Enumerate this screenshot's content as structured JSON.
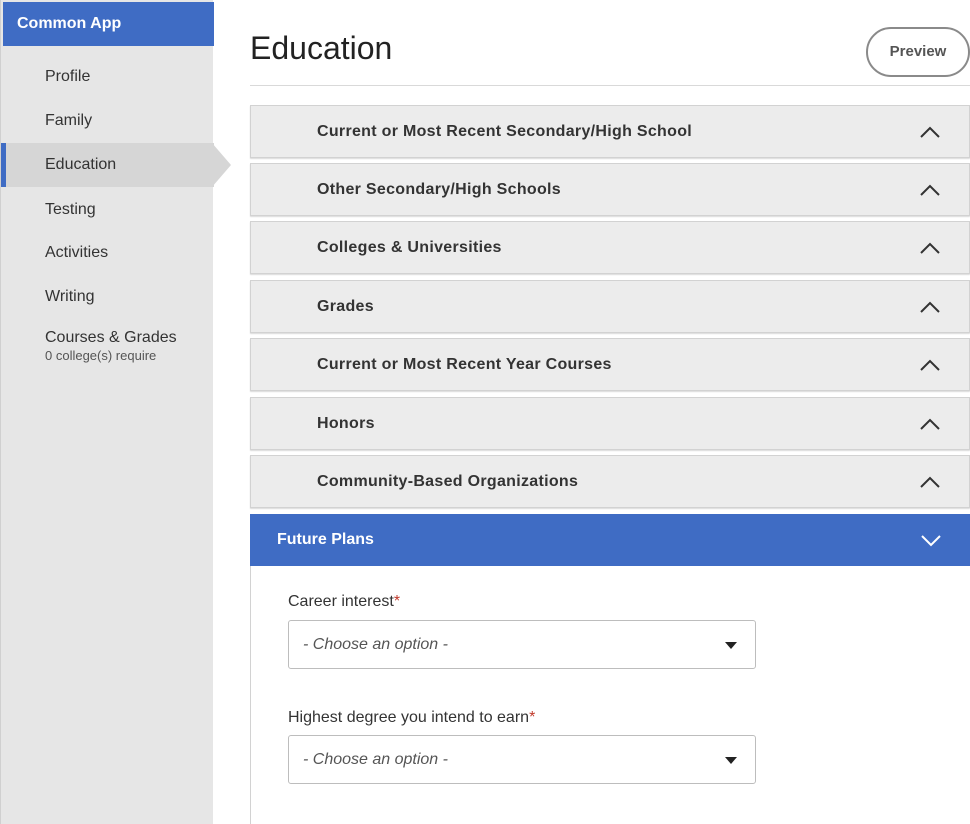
{
  "app": {
    "brand": "Common App"
  },
  "sidebar": {
    "items": [
      {
        "label": "Profile"
      },
      {
        "label": "Family"
      },
      {
        "label": "Education"
      },
      {
        "label": "Testing"
      },
      {
        "label": "Activities"
      },
      {
        "label": "Writing"
      },
      {
        "label": "Courses & Grades",
        "sublabel": "0 college(s) require"
      }
    ],
    "active": "Education"
  },
  "header": {
    "title": "Education",
    "preview_label": "Preview"
  },
  "sections": [
    {
      "label": "Current or Most Recent Secondary/High School",
      "icon": "chevron-up-icon"
    },
    {
      "label": "Other Secondary/High Schools",
      "icon": "chevron-up-icon"
    },
    {
      "label": "Colleges & Universities",
      "icon": "chevron-up-icon"
    },
    {
      "label": "Grades",
      "icon": "chevron-up-icon"
    },
    {
      "label": "Current or Most Recent Year Courses",
      "icon": "chevron-up-icon"
    },
    {
      "label": "Honors",
      "icon": "chevron-up-icon"
    },
    {
      "label": "Community-Based Organizations",
      "icon": "chevron-up-icon"
    }
  ],
  "future_plans": {
    "label": "Future Plans",
    "icon": "chevron-down-icon",
    "fields": [
      {
        "label": "Career interest",
        "required_mark": "*",
        "value": "- Choose an option -"
      },
      {
        "label": "Highest degree you intend to earn",
        "required_mark": "*",
        "value": "- Choose an option -"
      }
    ]
  },
  "colors": {
    "accent": "#3f6cc4",
    "required": "#c0392b",
    "sidebar_bg": "#e6e6e6",
    "section_bg": "#ececec"
  }
}
